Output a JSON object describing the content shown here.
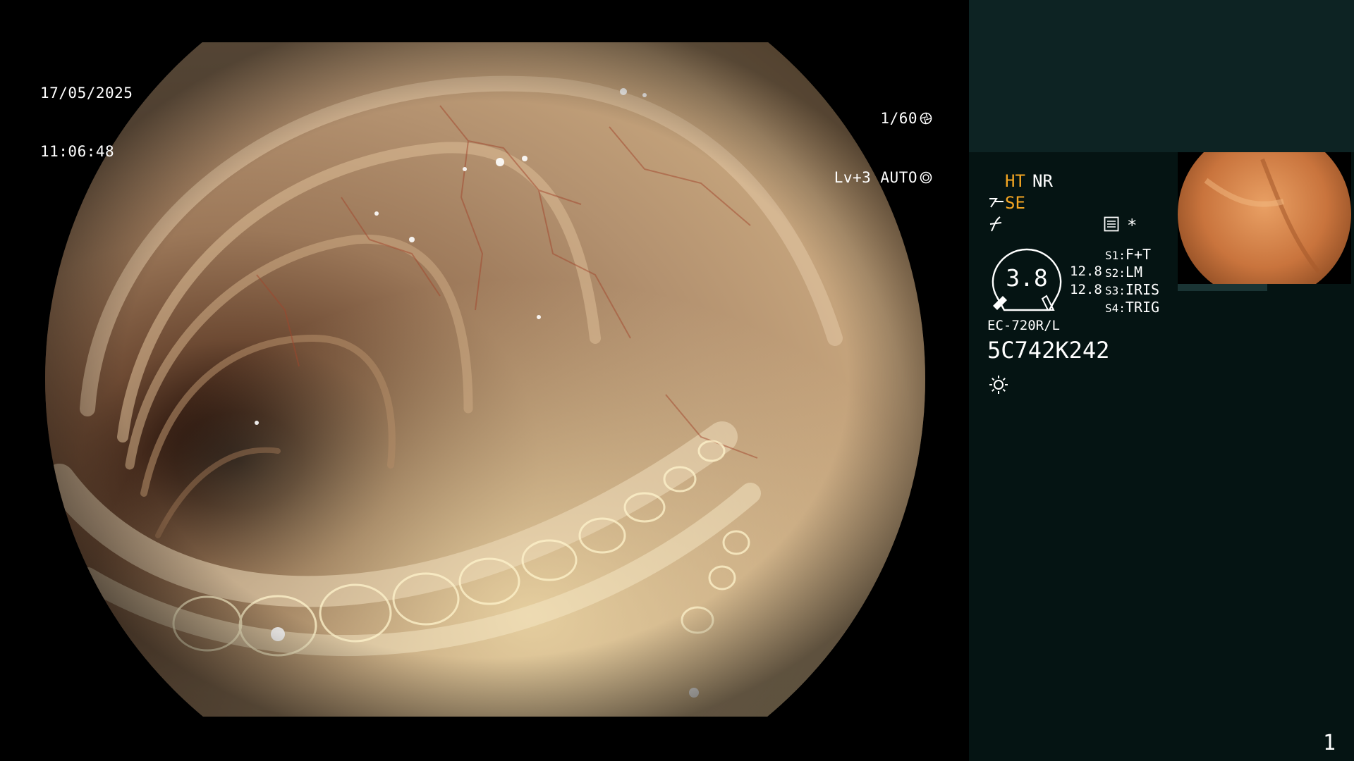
{
  "overlay": {
    "date": "17/05/2025",
    "time": "11:06:48",
    "shutter": "1/60",
    "iris": "Lv+3 AUTO"
  },
  "panel": {
    "ht": "HT",
    "nr": "NR",
    "se": "SE",
    "zoom_value": "3.8",
    "gain_1": "12.8",
    "gain_2": "12.8",
    "switches": [
      {
        "key": "S1:",
        "value": "F+T"
      },
      {
        "key": "S2:",
        "value": "LM"
      },
      {
        "key": "S3:",
        "value": "IRIS"
      },
      {
        "key": "S4:",
        "value": "TRIG"
      }
    ],
    "scope_model": "EC-720R/L",
    "serial": "5C742K242",
    "asterisk": "*"
  },
  "page_number": "1",
  "icons": [
    "shutter-icon",
    "iris-icon",
    "enhancement-icon",
    "filter-icon",
    "memory-icon",
    "light-icon"
  ],
  "colors": {
    "accent": "#f5a623",
    "panel_top": "#0d2323",
    "panel": "#051413"
  }
}
